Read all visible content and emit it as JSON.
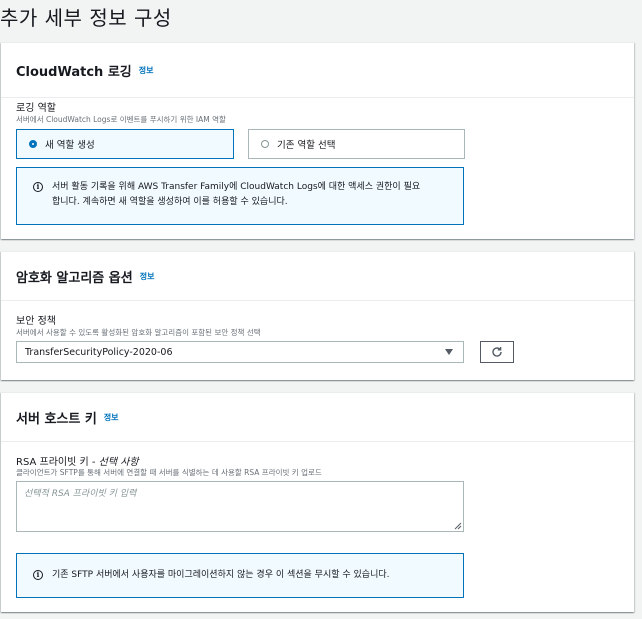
{
  "page": {
    "title": "추가 세부 정보 구성"
  },
  "cloudwatch": {
    "title": "CloudWatch 로깅",
    "info": "정보",
    "role_label": "로깅 역할",
    "role_desc": "서버에서 CloudWatch Logs로 이벤트를 푸시하기 위한 IAM 역할",
    "option_new": "새 역할 생성",
    "option_existing": "기존 역할 선택",
    "selected": "새 역할 생성",
    "alert_line1": "서버 활동 기록을 위해 AWS Transfer Family에 CloudWatch Logs에 대한 액세스 권한이 필요",
    "alert_line2": "합니다. 계속하면 새 역할을 생성하여 이를 허용할 수 있습니다."
  },
  "encryption": {
    "title": "암호화 알고리즘 옵션",
    "info": "정보",
    "policy_label": "보안 정책",
    "policy_desc": "서버에서 사용할 수 있도록 활성화된 암호화 알고리즘이 포함된 보안 정책 선택",
    "policy_value": "TransferSecurityPolicy-2020-06"
  },
  "hostkey": {
    "title": "서버 호스트 키",
    "info": "정보",
    "label_main": "RSA 프라이빗 키 - ",
    "label_optional": "선택 사항",
    "desc": "클라이언트가 SFTP를 통해 서버에 연결할 때 서버를 식별하는 데 사용할 RSA 프라이빗 키 업로드",
    "placeholder": "선택적 RSA 프라이빗 키 입력",
    "alert": "기존 SFTP 서버에서 사용자를 마이그레이션하지 않는 경우 이 섹션을 무시할 수 있습니다."
  },
  "colors": {
    "accent": "#0073bb",
    "alert_bg": "#f1faff",
    "page_bg": "#f2f3f3"
  },
  "icons": {
    "info": "info-circle-icon",
    "refresh": "refresh-icon",
    "caret": "caret-down-icon"
  }
}
